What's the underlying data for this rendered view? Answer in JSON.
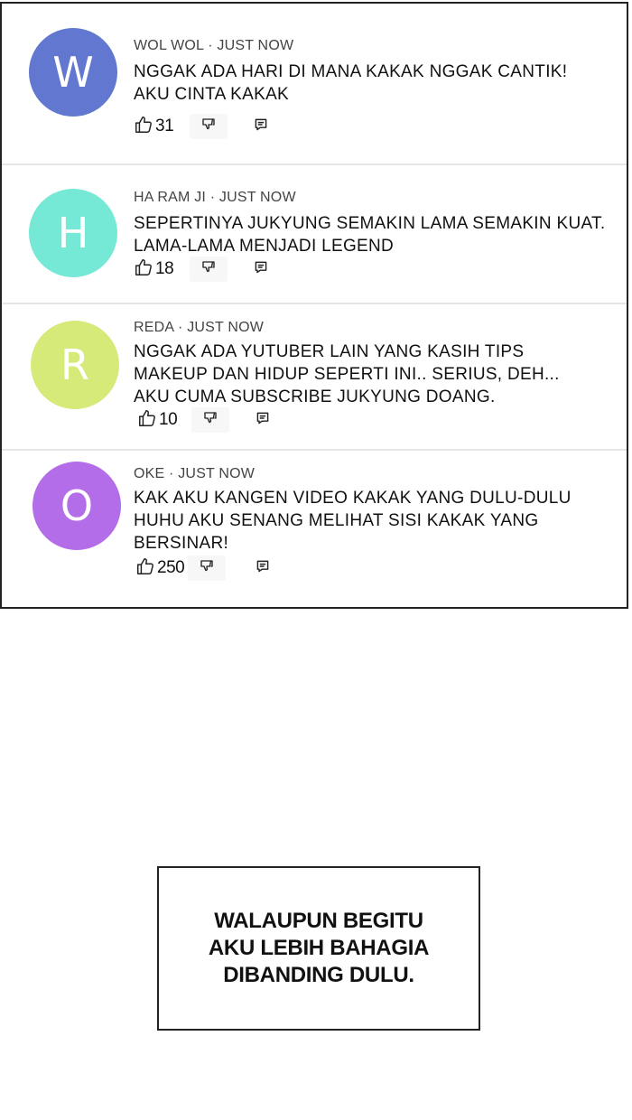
{
  "comments": [
    {
      "initial": "W",
      "avatar_color": "#6277cf",
      "author": "WOL WOL",
      "time": "JUST NOW",
      "lines": [
        "NGGAK ADA HARI DI MANA KAKAK NGGAK CANTIK!",
        "AKU CINTA KAKAK"
      ],
      "likes": "31"
    },
    {
      "initial": "H",
      "avatar_color": "#76e8d6",
      "author": "HA RAM JI",
      "time": "JUST NOW",
      "lines": [
        "SEPERTINYA JUKYUNG SEMAKIN LAMA SEMAKIN KUAT.",
        "LAMA-LAMA MENJADI LEGEND"
      ],
      "likes": "18"
    },
    {
      "initial": "R",
      "avatar_color": "#d6ea7a",
      "author": "REDA",
      "time": "JUST NOW",
      "lines": [
        "NGGAK ADA YUTUBER LAIN YANG KASIH TIPS",
        "MAKEUP DAN HIDUP SEPERTI INI.. SERIUS, DEH...",
        "AKU CUMA SUBSCRIBE JUKYUNG DOANG."
      ],
      "likes": "10"
    },
    {
      "initial": "O",
      "avatar_color": "#b46de8",
      "author": "OKE",
      "time": "JUST NOW",
      "lines": [
        "KAK AKU KANGEN VIDEO KAKAK YANG DULU-DULU",
        "HUHU AKU SENANG MELIHAT SISI KAKAK YANG",
        "BERSINAR!"
      ],
      "likes": "250"
    }
  ],
  "separator": "·",
  "icons": {
    "like": "thumbs-up-icon",
    "dislike": "thumbs-down-icon",
    "reply": "reply-icon"
  },
  "caption": {
    "lines": [
      "WALAUPUN BEGITU",
      "AKU LEBIH BAHAGIA",
      "DIBANDING DULU."
    ]
  }
}
